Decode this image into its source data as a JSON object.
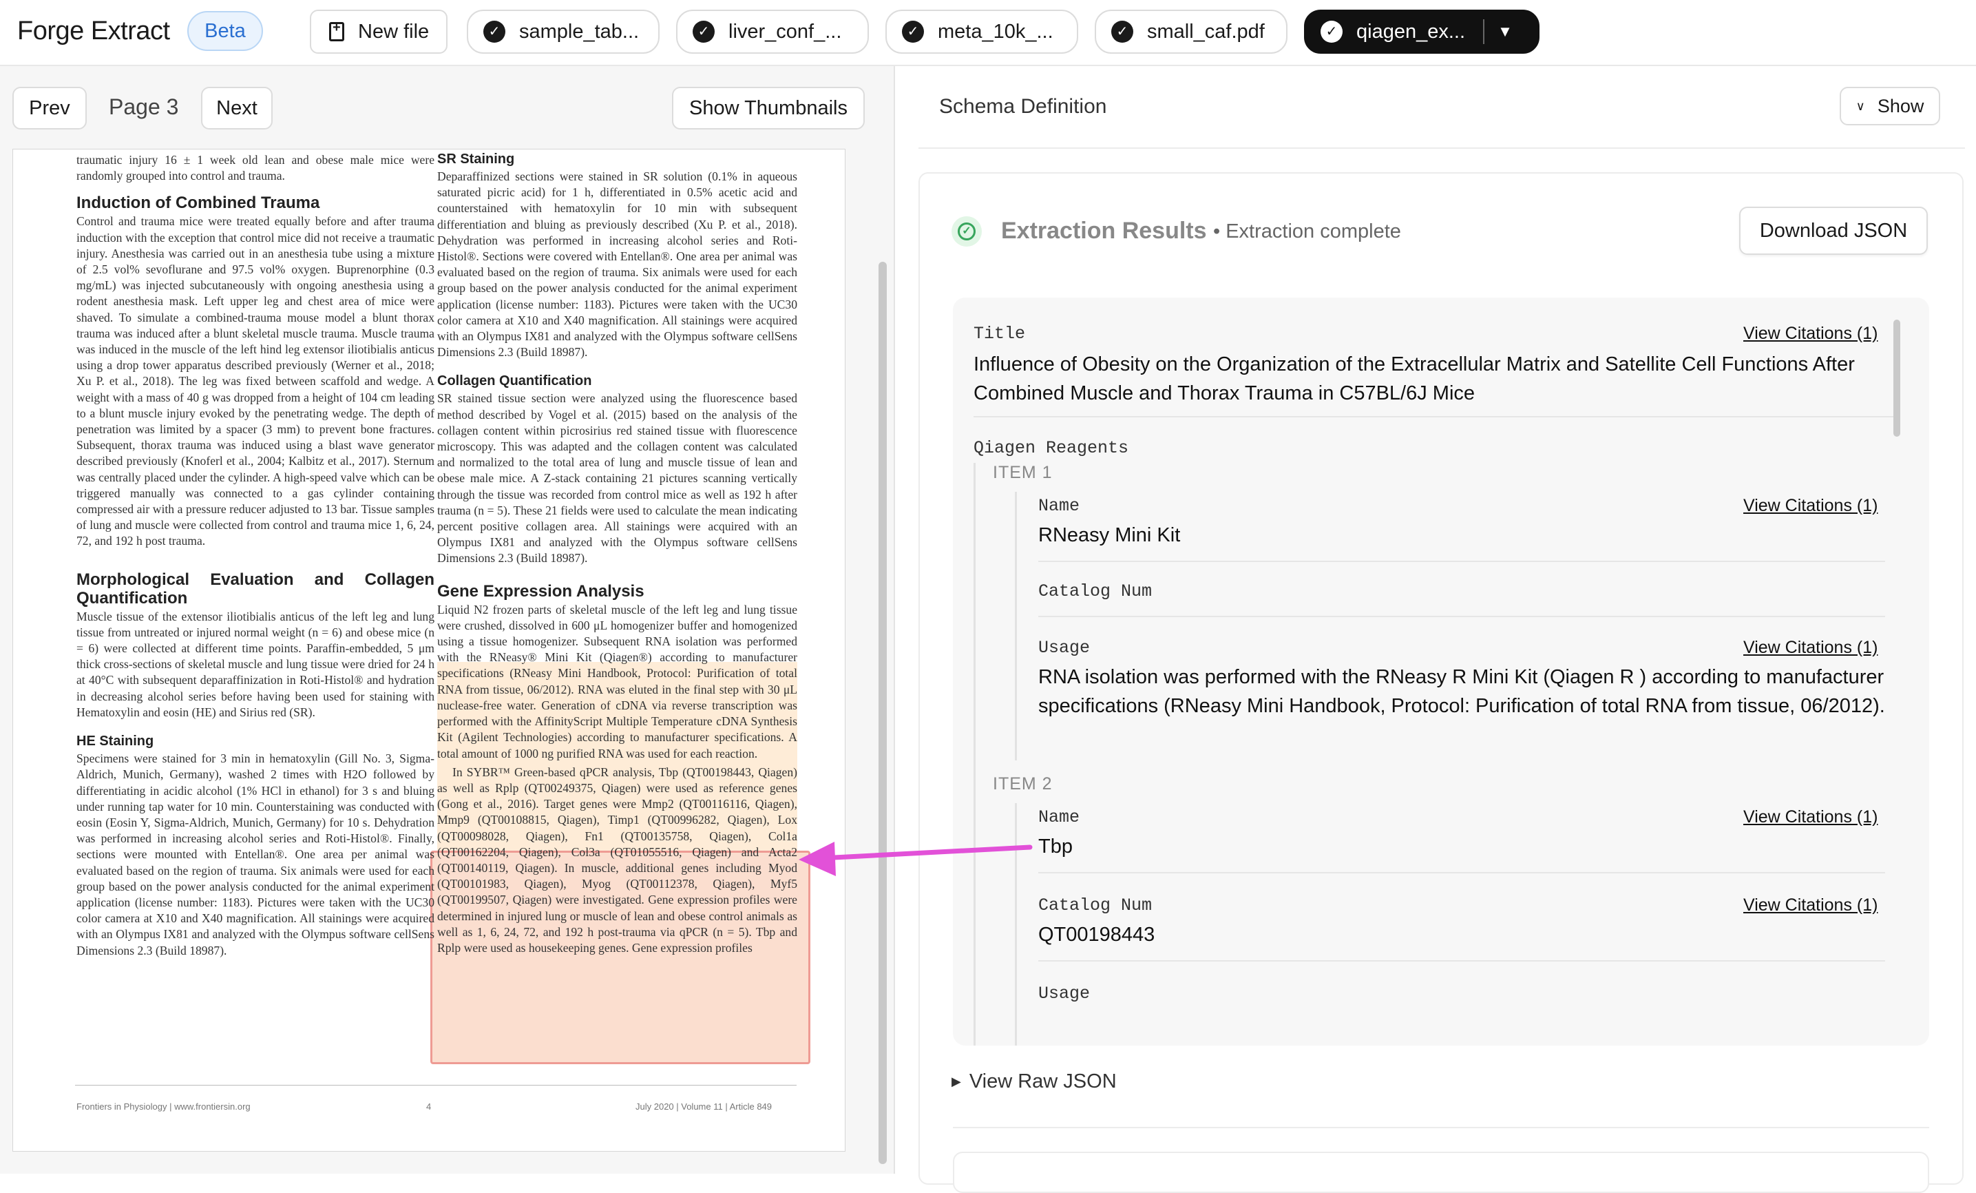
{
  "app": {
    "brand": "Forge Extract",
    "badge": "Beta"
  },
  "tabs": {
    "new_file": "New file",
    "files": [
      {
        "label": "sample_tab...",
        "active": false
      },
      {
        "label": "liver_conf_...",
        "active": false
      },
      {
        "label": "meta_10k_...",
        "active": false
      },
      {
        "label": "small_caf.pdf",
        "active": false
      },
      {
        "label": "qiagen_ex...",
        "active": true
      }
    ]
  },
  "viewer": {
    "prev": "Prev",
    "page_label": "Page 3",
    "next": "Next",
    "thumbnails": "Show Thumbnails"
  },
  "document": {
    "col1": {
      "intro": "traumatic injury 16 ± 1 week old lean and obese male mice were randomly grouped into control and trauma.",
      "h1": "Induction of Combined Trauma",
      "p1": "Control and trauma mice were treated equally before and after trauma induction with the exception that control mice did not receive a traumatic injury. Anesthesia was carried out in an anesthesia tube using a mixture of 2.5 vol% sevoflurane and 97.5 vol% oxygen. Buprenorphine (0.3 mg/mL) was injected subcutaneously with ongoing anesthesia using a rodent anesthesia mask. Left upper leg and chest area of mice were shaved. To simulate a combined-trauma mouse model a blunt thorax trauma was induced after a blunt skeletal muscle trauma. Muscle trauma was induced in the muscle of the left hind leg extensor iliotibialis anticus using a drop tower apparatus described previously (Werner et al., 2018; Xu P. et al., 2018). The leg was fixed between scaffold and wedge. A weight with a mass of 40 g was dropped from a height of 104 cm leading to a blunt muscle injury evoked by the penetrating wedge. The depth of penetration was limited by a spacer (3 mm) to prevent bone fractures. Subsequent, thorax trauma was induced using a blast wave generator described previously (Knoferl et al., 2004; Kalbitz et al., 2017). Sternum was centrally placed under the cylinder. A high-speed valve which can be triggered manually was connected to a gas cylinder containing compressed air with a pressure reducer adjusted to 13 bar. Tissue samples of lung and muscle were collected from control and trauma mice 1, 6, 24, 72, and 192 h post trauma.",
      "h2": "Morphological Evaluation and Collagen Quantification",
      "p2": "Muscle tissue of the extensor iliotibialis anticus of the left leg and lung tissue from untreated or injured normal weight (n = 6) and obese mice (n = 6) were collected at different time points. Paraffin-embedded, 5 μm thick cross-sections of skeletal muscle and lung tissue were dried for 24 h at 40°C with subsequent deparaffinization in Roti-Histol® and hydration in decreasing alcohol series before having been used for staining with Hematoxylin and eosin (HE) and Sirius red (SR).",
      "h3": "HE Staining",
      "p3": "Specimens were stained for 3 min in hematoxylin (Gill No. 3, Sigma-Aldrich, Munich, Germany), washed 2 times with H2O followed by differentiating in acidic alcohol (1% HCl in ethanol) for 3 s and bluing under running tap water for 10 min. Counterstaining was conducted with eosin (Eosin Y, Sigma-Aldrich, Munich, Germany) for 10 s. Dehydration was performed in increasing alcohol series and Roti-Histol®. Finally, sections were mounted with Entellan®. One area per animal was evaluated based on the region of trauma. Six animals were used for each group based on the power analysis conducted for the animal experiment application (license number: 1183). Pictures were taken with the UC30 color camera at X10 and X40 magnification. All stainings were acquired with an Olympus IX81 and analyzed with the Olympus software cellSens Dimensions 2.3 (Build 18987)."
    },
    "col2": {
      "h1": "SR Staining",
      "p1": "Deparaffinized sections were stained in SR solution (0.1% in aqueous saturated picric acid) for 1 h, differentiated in 0.5% acetic acid and counterstained with hematoxylin for 10 min with subsequent differentiation and bluing as previously described (Xu P. et al., 2018). Dehydration was performed in increasing alcohol series and Roti-Histol®. Sections were covered with Entellan®. One area per animal was evaluated based on the region of trauma. Six animals were used for each group based on the power analysis conducted for the animal experiment application (license number: 1183). Pictures were taken with the UC30 color camera at X10 and X40 magnification. All stainings were acquired with an Olympus IX81 and analyzed with the Olympus software cellSens Dimensions 2.3 (Build 18987).",
      "h2": "Collagen Quantification",
      "p2": "SR stained tissue section were analyzed using the fluorescence based method described by Vogel et al. (2015) based on the analysis of the collagen content within picrosirius red stained tissue with fluorescence microscopy. This was adapted and the collagen content was calculated and normalized to the total area of lung and muscle tissue of lean and obese male mice. A Z-stack containing 21 pictures scanning vertically through the tissue was recorded from control mice as well as 192 h after trauma (n = 5). These 21 fields were used to calculate the mean indicating percent positive collagen area. All stainings were acquired with an Olympus IX81 and analyzed with the Olympus software cellSens Dimensions 2.3 (Build 18987).",
      "h3": "Gene Expression Analysis",
      "p3": "Liquid N2 frozen parts of skeletal muscle of the left leg and lung tissue were crushed, dissolved in 600 μL homogenizer buffer and homogenized using a tissue homogenizer. Subsequent RNA isolation was performed with the RNeasy® Mini Kit (Qiagen®) according to manufacturer specifications (RNeasy Mini Handbook, Protocol: Purification of total RNA from tissue, 06/2012). RNA was eluted in the final step with 30 μL nuclease-free water. Generation of cDNA via reverse transcription was performed with the AffinityScript Multiple Temperature cDNA Synthesis Kit (Agilent Technologies) according to manufacturer specifications. A total amount of 1000 ng purified RNA was used for each reaction.",
      "p4": "In SYBR™ Green-based qPCR analysis, Tbp (QT00198443, Qiagen) as well as Rplp (QT00249375, Qiagen) were used as reference genes (Gong et al., 2016). Target genes were Mmp2 (QT00116116, Qiagen), Mmp9 (QT00108815, Qiagen), Timp1 (QT00996282, Qiagen), Lox (QT00098028, Qiagen), Fn1 (QT00135758, Qiagen), Col1a (QT00162204, Qiagen), Col3a (QT01055516, Qiagen) and Acta2 (QT00140119, Qiagen). In muscle, additional genes including Myod (QT00101983, Qiagen), Myog (QT00112378, Qiagen), Myf5 (QT00199507, Qiagen) were investigated. Gene expression profiles were determined in injured lung or muscle of lean and obese control animals as well as 1, 6, 24, 72, and 192 h post-trauma via qPCR (n = 5). Tbp and Rplp were used as housekeeping genes. Gene expression profiles"
    },
    "footer": {
      "left": "Frontiers in Physiology | www.frontiersin.org",
      "center": "4",
      "right": "July 2020 | Volume 11 | Article 849"
    }
  },
  "schema": {
    "title": "Schema Definition",
    "show": "Show"
  },
  "results": {
    "title": "Extraction Results",
    "status": "• Extraction complete",
    "download": "Download JSON",
    "cite": "View Citations (1)",
    "title_key": "Title",
    "title_value": "Influence of Obesity on the Organization of the Extracellular Matrix and Satellite Cell Functions After Combined Muscle and Thorax Trauma in C57BL/6J Mice",
    "reagents_key": "Qiagen Reagents",
    "items": [
      {
        "label": "ITEM 1",
        "name_key": "Name",
        "name": "RNeasy Mini Kit",
        "catalog_key": "Catalog Num",
        "catalog": "",
        "usage_key": "Usage",
        "usage": "RNA isolation was performed with the RNeasy R Mini Kit (Qiagen R ) according to manufacturer specifications (RNeasy Mini Handbook, Protocol: Purification of total RNA from tissue, 06/2012)."
      },
      {
        "label": "ITEM 2",
        "name_key": "Name",
        "name": "Tbp",
        "catalog_key": "Catalog Num",
        "catalog": "QT00198443",
        "usage_key": "Usage",
        "usage": ""
      }
    ],
    "raw_json": "View Raw JSON"
  },
  "colors": {
    "accent": "#2a6fd1",
    "highlight": "#ee9b94",
    "arrow": "#e251d8",
    "ok": "#38a55c"
  }
}
